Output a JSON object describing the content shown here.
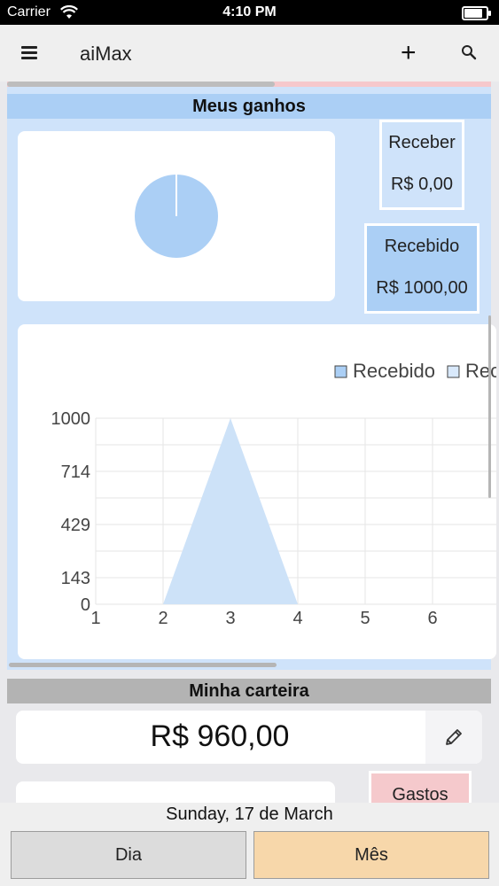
{
  "status_bar": {
    "carrier": "Carrier",
    "time": "4:10 PM",
    "battery_level": 1.0
  },
  "nav": {
    "title": "aiMax",
    "add_label": "+"
  },
  "earnings": {
    "title": "Meus ganhos",
    "receber": {
      "label": "Receber",
      "value": "R$ 0,00"
    },
    "recebido": {
      "label": "Recebido",
      "value": "R$ 1000,00"
    }
  },
  "chart_data": [
    {
      "type": "pie",
      "values": [
        0,
        1000
      ],
      "labels": [
        "Receber",
        "Recebido"
      ],
      "colors": [
        "#e3effc",
        "#abcff5"
      ]
    },
    {
      "type": "area",
      "legend": [
        "Recebido",
        "Rec"
      ],
      "legend_position": "top-right",
      "x": [
        1,
        2,
        3,
        4,
        5,
        6
      ],
      "series": [
        {
          "name": "Recebido",
          "values": [
            0,
            0,
            1000,
            0,
            0,
            0
          ]
        }
      ],
      "y_ticks": [
        "1000",
        "714",
        "429",
        "143",
        "0"
      ],
      "x_ticks": [
        "1",
        "2",
        "3",
        "4",
        "5",
        "6"
      ],
      "ylim": [
        0,
        1000
      ],
      "grid": true,
      "fill_color": "#cde2f8"
    }
  ],
  "wallet": {
    "title": "Minha carteira",
    "amount": "R$ 960,00",
    "gastos_label": "Gastos"
  },
  "footer": {
    "date": "Sunday, 17 de March",
    "dia_label": "Dia",
    "mes_label": "Mês"
  }
}
